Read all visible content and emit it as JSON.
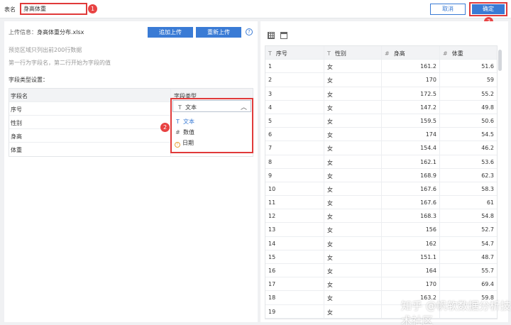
{
  "header": {
    "table_name_label": "表名",
    "table_name_value": "身高体重",
    "cancel_label": "取消",
    "ok_label": "确定"
  },
  "annotations": [
    "1",
    "2",
    "3"
  ],
  "left": {
    "upload_label": "上传信息：",
    "upload_file": "身高体重分布.xlsx",
    "append_btn": "追加上传",
    "reupload_btn": "重新上传",
    "help_icon": "?",
    "hint1": "预览区域只列出前200行数据",
    "hint2": "第一行为字段名，第二行开始为字段的值",
    "field_settings_title": "字段类型设置：",
    "columns": [
      "字段名",
      "字段类型"
    ],
    "fields": [
      "序号",
      "性别",
      "身高",
      "体重"
    ],
    "dropdown": {
      "selected": "文本",
      "options": [
        "文本",
        "数值",
        "日期"
      ]
    }
  },
  "preview": {
    "columns": [
      {
        "icon": "T",
        "name": "序号"
      },
      {
        "icon": "T",
        "name": "性别"
      },
      {
        "icon": "#",
        "name": "身高"
      },
      {
        "icon": "#",
        "name": "体重"
      }
    ],
    "rows": [
      [
        "1",
        "女",
        "161.2",
        "51.6"
      ],
      [
        "2",
        "女",
        "170",
        "59"
      ],
      [
        "3",
        "女",
        "172.5",
        "55.2"
      ],
      [
        "4",
        "女",
        "147.2",
        "49.8"
      ],
      [
        "5",
        "女",
        "159.5",
        "50.6"
      ],
      [
        "6",
        "女",
        "174",
        "54.5"
      ],
      [
        "7",
        "女",
        "154.4",
        "46.2"
      ],
      [
        "8",
        "女",
        "162.1",
        "53.6"
      ],
      [
        "9",
        "女",
        "168.9",
        "62.3"
      ],
      [
        "10",
        "女",
        "167.6",
        "58.3"
      ],
      [
        "11",
        "女",
        "167.6",
        "61"
      ],
      [
        "12",
        "女",
        "168.3",
        "54.8"
      ],
      [
        "13",
        "女",
        "156",
        "52.7"
      ],
      [
        "14",
        "女",
        "162",
        "54.7"
      ],
      [
        "15",
        "女",
        "151.1",
        "48.7"
      ],
      [
        "16",
        "女",
        "164",
        "55.7"
      ],
      [
        "17",
        "女",
        "170",
        "69.4"
      ],
      [
        "18",
        "女",
        "163.2",
        "59.8"
      ],
      [
        "19",
        "女",
        "",
        ""
      ]
    ]
  },
  "watermark": "知乎 @帆软数据分析技术社区",
  "colors": {
    "accent": "#3a7bd5",
    "highlight": "#e03a3a"
  }
}
